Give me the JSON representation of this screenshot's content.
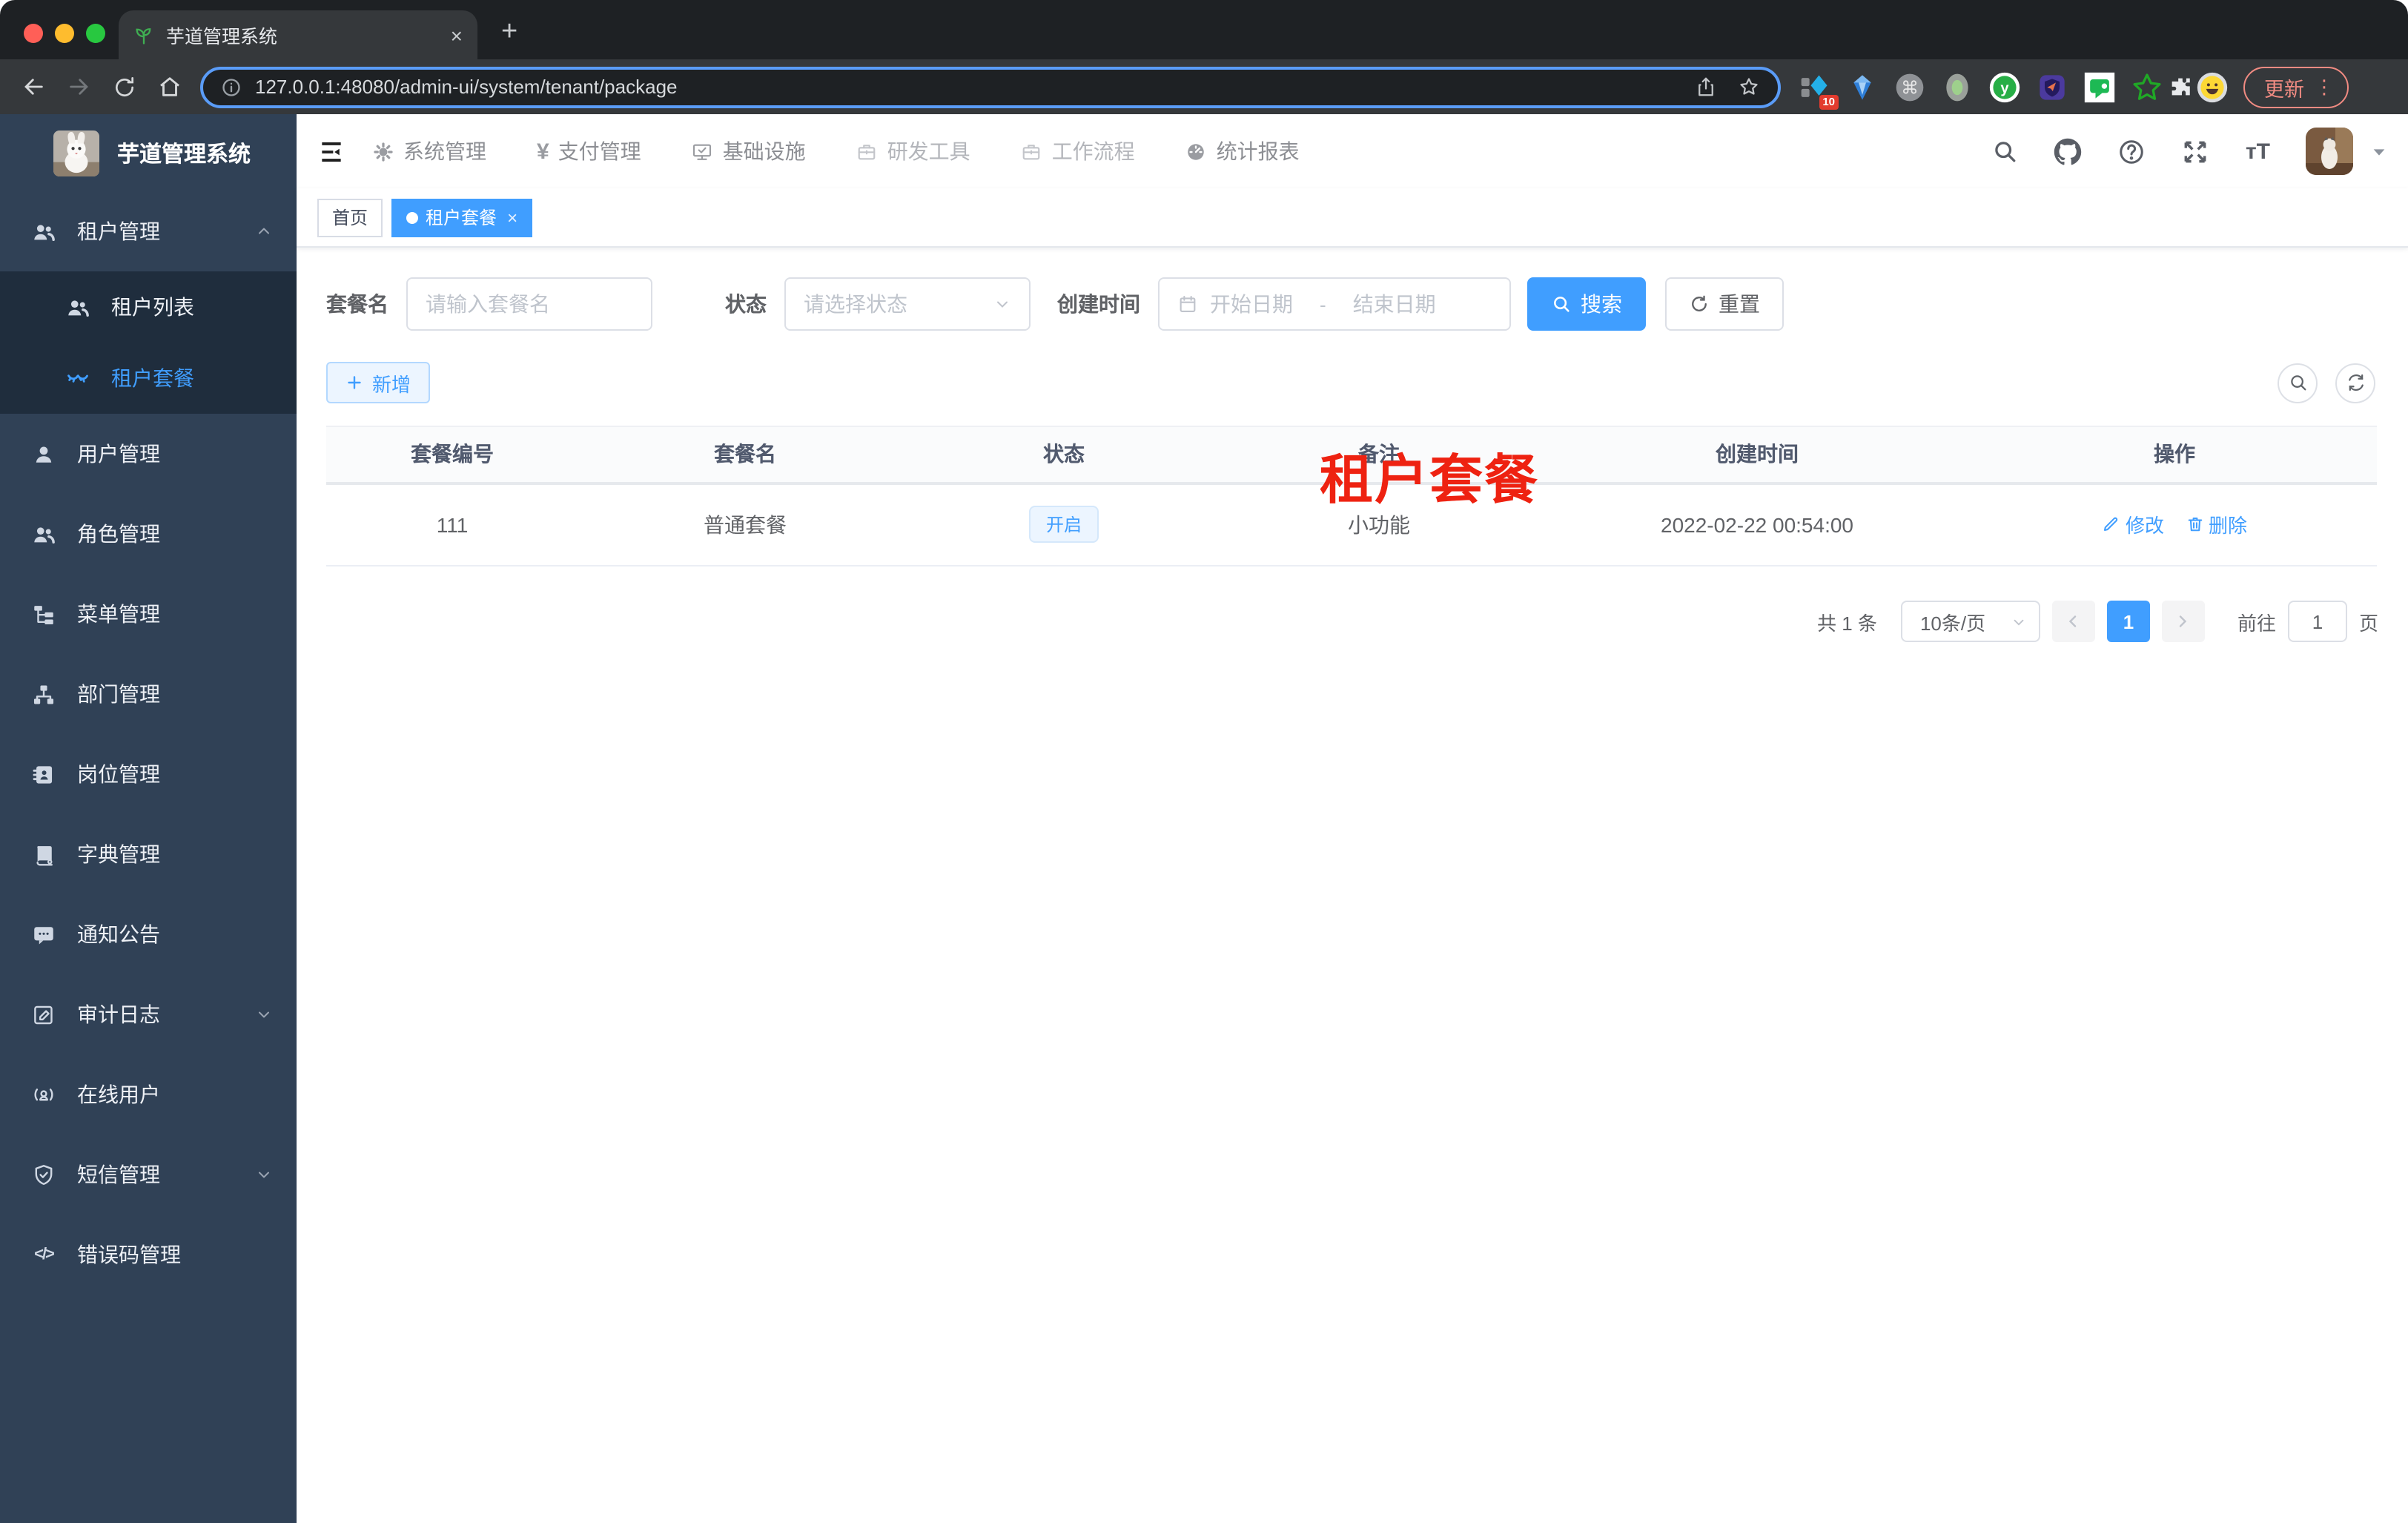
{
  "browser": {
    "tab": {
      "favicon": "sprout-icon",
      "title": "芋道管理系统",
      "close_glyph": "×",
      "new_tab_glyph": "+"
    },
    "url": "127.0.0.1:48080/admin-ui/system/tenant/package",
    "extensions": [
      {
        "icon": "grid-diamond-extension-icon",
        "badge": "10"
      },
      {
        "icon": "gem-extension-icon"
      },
      {
        "icon": "command-extension-icon"
      },
      {
        "icon": "record-extension-icon"
      },
      {
        "icon": "y-circle-extension-icon"
      },
      {
        "icon": "shield-purple-extension-icon"
      },
      {
        "icon": "chat-green-extension-icon"
      },
      {
        "icon": "star-green-extension-icon"
      }
    ],
    "update_label": "更新",
    "menu_dots": "⋮"
  },
  "app": {
    "logo_title": "芋道管理系统",
    "top_nav": [
      {
        "icon": "gear-icon",
        "label": "系统管理",
        "muted": false
      },
      {
        "icon": "yen-icon",
        "label": "支付管理",
        "muted": false
      },
      {
        "icon": "monitor-icon",
        "label": "基础设施",
        "muted": false
      },
      {
        "icon": "briefcase-icon",
        "label": "研发工具",
        "muted": true
      },
      {
        "icon": "briefcase-icon",
        "label": "工作流程",
        "muted": true
      },
      {
        "icon": "dashboard-icon",
        "label": "统计报表",
        "muted": false
      }
    ],
    "sidebar": [
      {
        "icon": "users-icon",
        "label": "租户管理",
        "chevron": "up",
        "children": [
          {
            "icon": "users-icon",
            "label": "租户列表",
            "active": false
          },
          {
            "icon": "lashes-icon",
            "label": "租户套餐",
            "active": true
          }
        ]
      },
      {
        "icon": "user-icon",
        "label": "用户管理"
      },
      {
        "icon": "users-icon",
        "label": "角色管理"
      },
      {
        "icon": "tree-icon",
        "label": "菜单管理"
      },
      {
        "icon": "sitemap-icon",
        "label": "部门管理"
      },
      {
        "icon": "badge-icon",
        "label": "岗位管理"
      },
      {
        "icon": "dict-icon",
        "label": "字典管理"
      },
      {
        "icon": "message-icon",
        "label": "通知公告"
      },
      {
        "icon": "log-icon",
        "label": "审计日志",
        "chevron": "down"
      },
      {
        "icon": "online-icon",
        "label": "在线用户"
      },
      {
        "icon": "shield-icon",
        "label": "短信管理",
        "chevron": "down"
      },
      {
        "icon": "code-icon",
        "label": "错误码管理"
      }
    ],
    "tags": [
      {
        "label": "首页",
        "active": false
      },
      {
        "label": "租户套餐",
        "active": true,
        "close_glyph": "×"
      }
    ],
    "watermark": "租户套餐",
    "filters": {
      "name_label": "套餐名",
      "name_placeholder": "请输入套餐名",
      "status_label": "状态",
      "status_placeholder": "请选择状态",
      "date_label": "创建时间",
      "date_start_placeholder": "开始日期",
      "date_separator": "-",
      "date_end_placeholder": "结束日期",
      "search_label": "搜索",
      "reset_label": "重置"
    },
    "toolbar": {
      "add_label": "新增"
    },
    "table": {
      "columns": [
        "套餐编号",
        "套餐名",
        "状态",
        "备注",
        "创建时间",
        "操作"
      ],
      "rows": [
        {
          "id": "111",
          "name": "普通套餐",
          "status": "开启",
          "remark": "小功能",
          "created_at": "2022-02-22 00:54:00",
          "actions": [
            {
              "icon": "pen-icon",
              "label": "修改"
            },
            {
              "icon": "trash-icon",
              "label": "删除"
            }
          ]
        }
      ]
    },
    "pagination": {
      "total_text": "共 1 条",
      "page_size": "10条/页",
      "current_page": "1",
      "goto_label": "前往",
      "goto_value": "1",
      "page_unit": "页"
    }
  },
  "colors": {
    "primary": "#409eff",
    "sidebar_bg": "#304156",
    "submenu_bg": "#1f2d3d",
    "watermark_red": "#ee2211",
    "tag_active_bg": "#409eff",
    "chrome_dark": "#1e2124",
    "toolbar_dark": "#35383b",
    "update_pink": "#f08b82",
    "status_tag_bg": "#ecf5ff"
  }
}
